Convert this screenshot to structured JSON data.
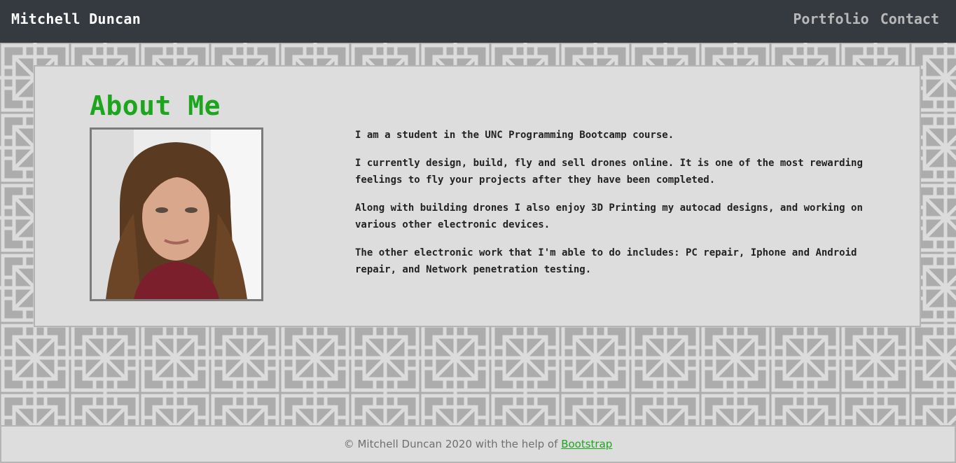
{
  "navbar": {
    "brand": "Mitchell Duncan",
    "links": [
      "Portfolio",
      "Contact"
    ]
  },
  "about": {
    "title": "About Me",
    "paragraphs": [
      "I am a student in the UNC Programming Bootcamp course.",
      "I currently design, build, fly and sell drones online. It is one of the most rewarding feelings to fly your projects after they have been completed.",
      "Along with building drones I also enjoy 3D Printing my autocad designs, and working on various other electronic devices.",
      "The other electronic work that I'm able to do includes: PC repair, Iphone and Android repair, and Network penetration testing."
    ]
  },
  "footer": {
    "text": "© Mitchell Duncan 2020 with the help of",
    "link_label": "Bootstrap"
  },
  "colors": {
    "navbar_bg": "#343a40",
    "accent_green": "#1ea51e",
    "card_bg": "#dddddd",
    "pattern_bg": "#acacac",
    "pattern_line": "#dcdcdc"
  }
}
